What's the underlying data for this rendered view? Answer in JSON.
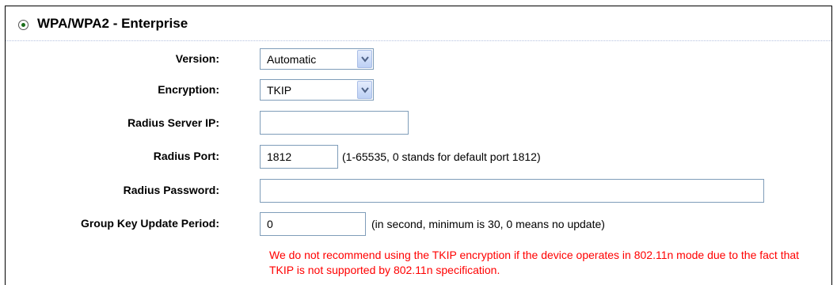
{
  "section": {
    "title": "WPA/WPA2 - Enterprise",
    "selected": true
  },
  "fields": {
    "version": {
      "label": "Version:",
      "value": "Automatic"
    },
    "encryption": {
      "label": "Encryption:",
      "value": "TKIP"
    },
    "radius_server_ip": {
      "label": "Radius Server IP:",
      "value": ""
    },
    "radius_port": {
      "label": "Radius Port:",
      "value": "1812",
      "hint": "(1-65535, 0 stands for default port 1812)"
    },
    "radius_password": {
      "label": "Radius Password:",
      "value": ""
    },
    "group_key_update_period": {
      "label": "Group Key Update Period:",
      "value": "0",
      "hint": "(in second, minimum is 30, 0 means no update)"
    }
  },
  "warning": {
    "text": "We do not recommend using the TKIP encryption if the device operates in 802.11n mode due to the fact that TKIP is not supported by 802.11n specification.",
    "color": "#ff0000"
  },
  "icons": {
    "radio": "radio-selected-icon",
    "dropdown": "chevron-down-icon"
  }
}
